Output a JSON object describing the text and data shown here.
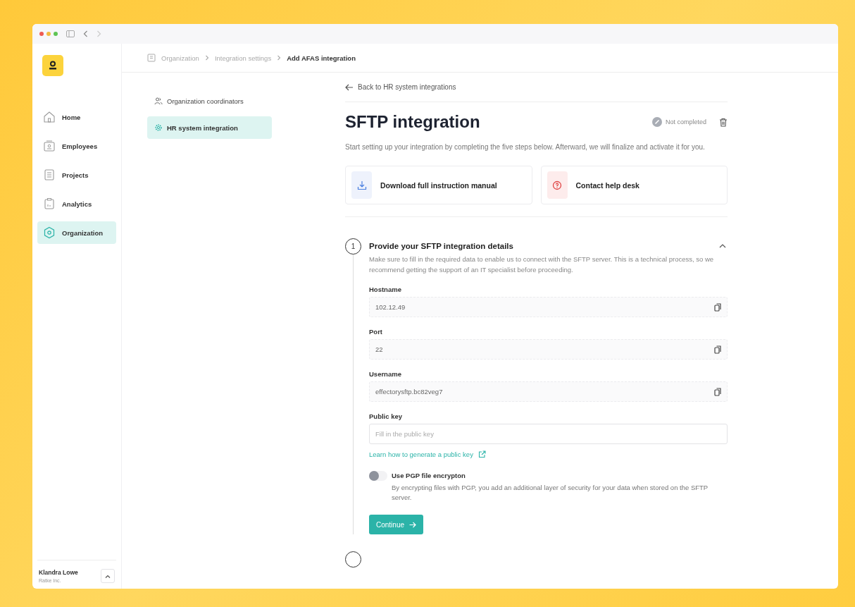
{
  "sidebar": {
    "items": [
      {
        "kind": "home",
        "label": "Home",
        "selected": false
      },
      {
        "kind": "employees",
        "label": "Employees",
        "selected": false
      },
      {
        "kind": "projects",
        "label": "Projects",
        "selected": false
      },
      {
        "kind": "analytics",
        "label": "Analytics",
        "selected": false
      },
      {
        "kind": "organization",
        "label": "Organization",
        "selected": true
      }
    ],
    "user": {
      "name": "Klandra Lowe",
      "company": "Ratke Inc."
    }
  },
  "breadcrumb": [
    {
      "label": "Organization",
      "current": false
    },
    {
      "label": "Integration settings",
      "current": false
    },
    {
      "label": "Add AFAS integration",
      "current": true
    }
  ],
  "settings_nav": [
    {
      "kind": "people",
      "label": "Organization coordinators",
      "selected": false
    },
    {
      "kind": "gear",
      "label": "HR system integration",
      "selected": true
    }
  ],
  "page": {
    "back_link": "Back to HR system integrations",
    "title": "SFTP integration",
    "status": "Not completed",
    "description": "Start setting up your integration by completing the five steps below. Afterward, we will finalize and activate it for you.",
    "actions": [
      {
        "kind": "download",
        "label": "Download full instruction manual"
      },
      {
        "kind": "help",
        "label": "Contact help desk"
      }
    ],
    "steps": [
      {
        "number": "1",
        "title": "Provide your SFTP integration details",
        "expanded": true,
        "description": "Make sure to fill in the required data to enable us to connect with the SFTP server. This is a technical process, so we recommend getting the support of an IT specialist before proceeding.",
        "fields": [
          {
            "kind": "readonly",
            "label": "Hostname",
            "value": "102.12.49"
          },
          {
            "kind": "readonly",
            "label": "Port",
            "value": "22"
          },
          {
            "kind": "readonly",
            "label": "Username",
            "value": "effectorysftp.bc82veg7"
          },
          {
            "kind": "input",
            "label": "Public key",
            "placeholder": "Fill in the public key"
          }
        ],
        "link": "Learn how to generate a public key",
        "toggle": {
          "label": "Use PGP file encrypton",
          "description": "By encrypting files with PGP, you add an additional layer of security for your data when stored on the SFTP server.",
          "on": false
        },
        "button": "Continue"
      }
    ]
  }
}
